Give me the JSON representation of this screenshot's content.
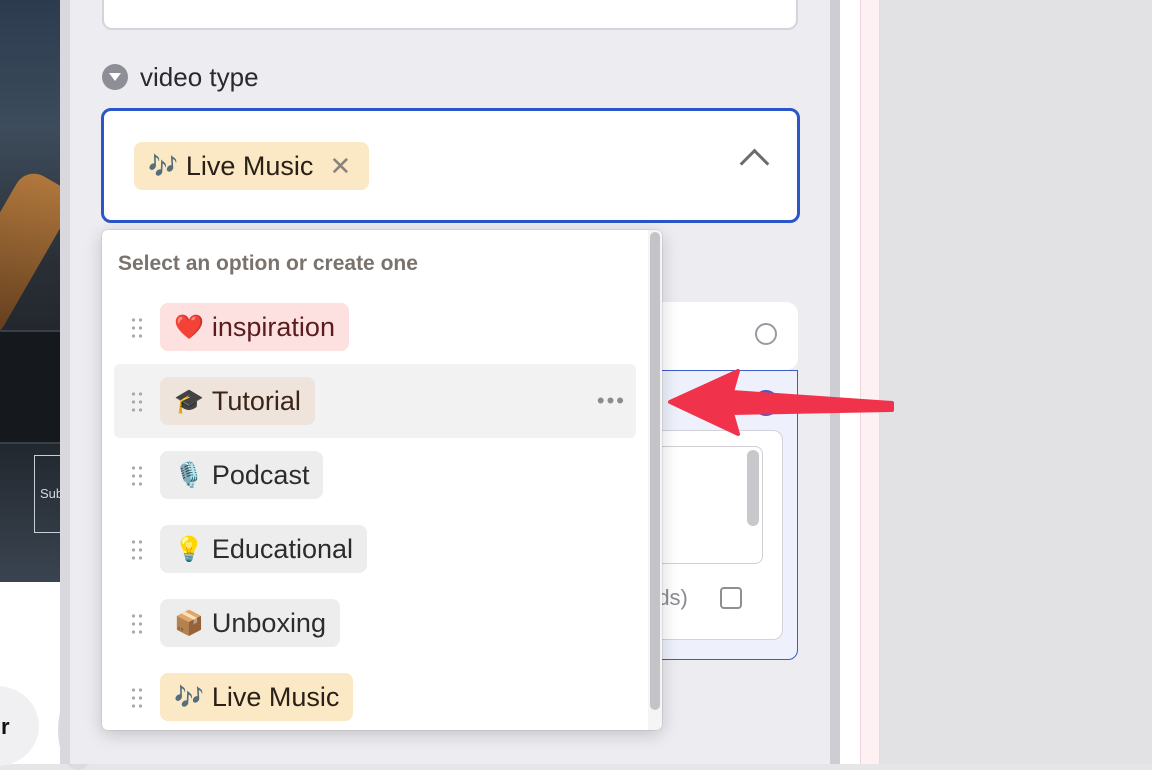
{
  "background": {
    "subscribe_text": "Subs",
    "round_button_text": "r"
  },
  "field": {
    "label": "video type",
    "selected": {
      "emoji": "🎶",
      "label": "Live Music",
      "remove_glyph": "✕"
    }
  },
  "dropdown": {
    "header": "Select an option or create one",
    "options": [
      {
        "emoji": "❤️",
        "label": "inspiration",
        "color": "#fde0e0"
      },
      {
        "emoji": "🎓",
        "label": "Tutorial",
        "color": "#efe4dc",
        "hovered": true,
        "more_glyph": "•••"
      },
      {
        "emoji": "🎙️",
        "label": "Podcast",
        "color": "#ededee"
      },
      {
        "emoji": "💡",
        "label": "Educational",
        "color": "#ededee"
      },
      {
        "emoji": "📦",
        "label": "Unboxing",
        "color": "#ededee"
      },
      {
        "emoji": "🎶",
        "label": "Live Music",
        "color": "#fbe8c4"
      }
    ]
  },
  "behind": {
    "words_text": "rds)"
  },
  "colors": {
    "accent": "#2b56c7",
    "arrow": "#f0334a"
  }
}
